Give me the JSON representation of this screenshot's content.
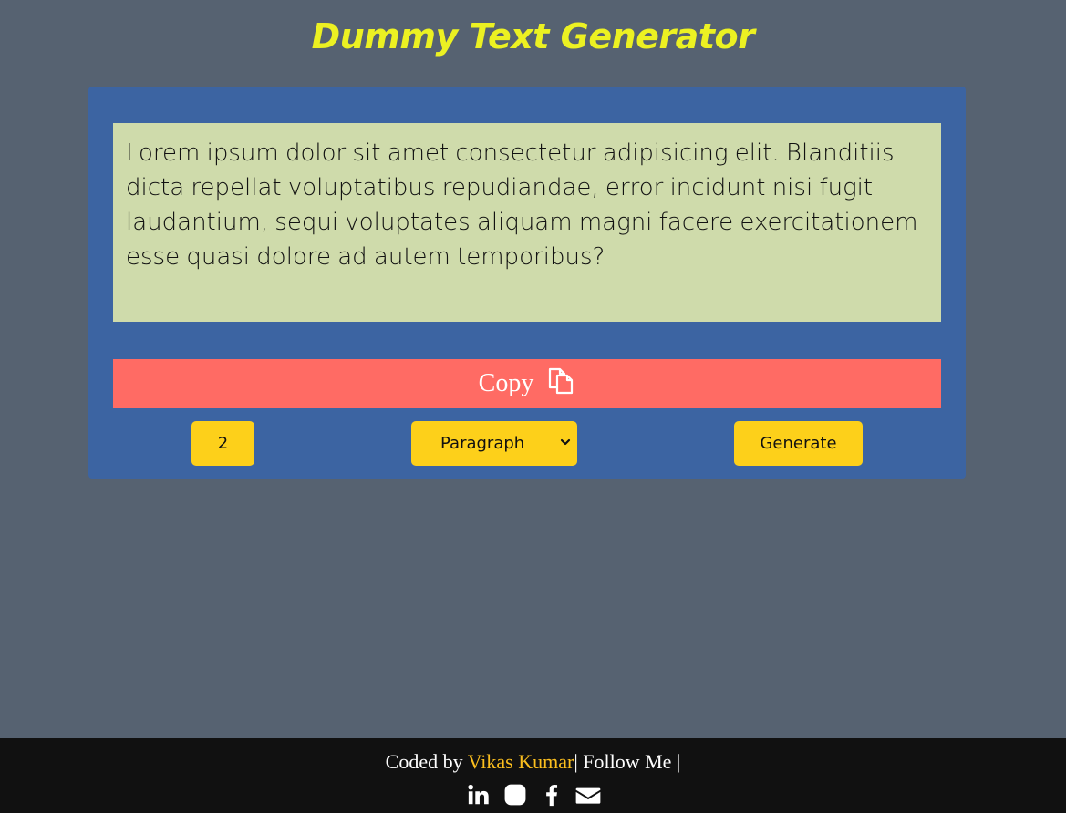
{
  "header": {
    "title": "Dummy Text Generator"
  },
  "output": {
    "text": "Lorem ipsum dolor sit amet consectetur adipisicing elit. Blanditiis dicta repellat voluptatibus repudiandae, error incidunt nisi fugit laudantium, sequi voluptates aliquam magni facere exercitationem esse quasi dolore ad autem temporibus?"
  },
  "copy_button": {
    "label": "Copy",
    "icon": "copy-icon"
  },
  "controls": {
    "count_value": "2",
    "type_selected": "Paragraph",
    "generate_label": "Generate"
  },
  "footer": {
    "coded_by": "Coded by ",
    "author": "Vikas Kumar",
    "follow": "| Follow Me |",
    "socials": [
      "linkedin-icon",
      "instagram-icon",
      "facebook-icon",
      "email-icon"
    ]
  },
  "colors": {
    "background": "#566271",
    "title": "#ecf122",
    "card": "#3c64a2",
    "output_bg": "#cfdbab",
    "copy_button": "#ff6b64",
    "controls": "#fdd01a",
    "footer_bg": "#111111",
    "author": "#fcbf1e"
  }
}
